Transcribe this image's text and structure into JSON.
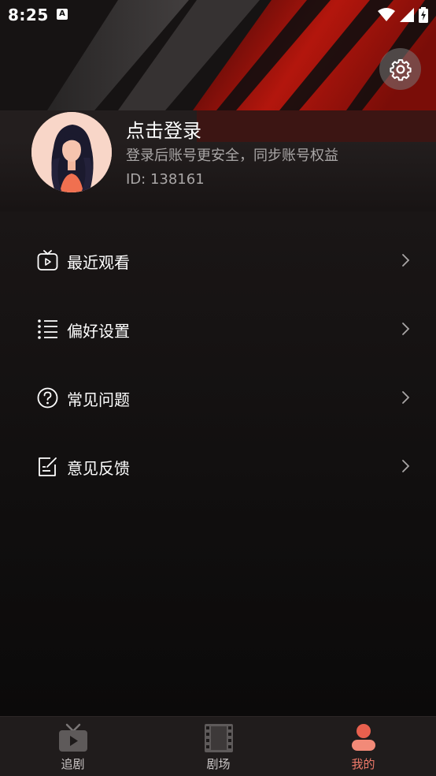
{
  "status_bar": {
    "time": "8:25",
    "notification_icon": "a-badge-icon",
    "right_icons": [
      "wifi-icon",
      "signal-icon",
      "battery-charging-icon"
    ]
  },
  "header": {
    "settings_icon": "gear-icon",
    "avatar_icon": "avatar-woman-icon",
    "login_title": "点击登录",
    "login_subtitle": "登录后账号更安全，同步账号权益",
    "user_id": "ID: 138161"
  },
  "menu": {
    "items": [
      {
        "label": "最近观看",
        "icon": "tv-play-icon"
      },
      {
        "label": "偏好设置",
        "icon": "list-icon"
      },
      {
        "label": "常见问题",
        "icon": "question-circle-icon"
      },
      {
        "label": "意见反馈",
        "icon": "edit-note-icon"
      }
    ],
    "chevron_icon": "chevron-right-icon"
  },
  "bottom_nav": {
    "items": [
      {
        "label": "追剧",
        "icon": "tv-icon",
        "active": false
      },
      {
        "label": "剧场",
        "icon": "film-icon",
        "active": false
      },
      {
        "label": "我的",
        "icon": "person-icon",
        "active": true
      }
    ],
    "active_color": "#f07a6a"
  },
  "colors": {
    "background": "#0d0b0b",
    "accent": "#f07a6a",
    "hero_red": "#c0180f",
    "secondary_text": "#a9a6a6"
  }
}
